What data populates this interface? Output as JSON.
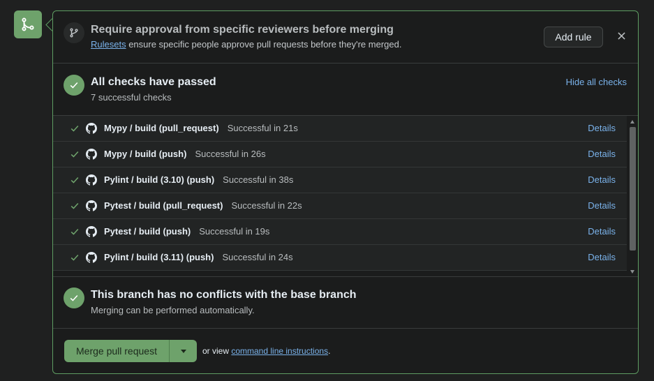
{
  "review": {
    "title": "Require approval from specific reviewers before merging",
    "link": "Rulesets",
    "subtitle_rest": " ensure specific people approve pull requests before they're merged.",
    "add_rule_label": "Add rule"
  },
  "checks": {
    "title": "All checks have passed",
    "subtitle": "7 successful checks",
    "hide_label": "Hide all checks",
    "items": [
      {
        "name": "Mypy / build (pull_request)",
        "status": "Successful in 21s",
        "details": "Details"
      },
      {
        "name": "Mypy / build (push)",
        "status": "Successful in 26s",
        "details": "Details"
      },
      {
        "name": "Pylint / build (3.10) (push)",
        "status": "Successful in 38s",
        "details": "Details"
      },
      {
        "name": "Pytest / build (pull_request)",
        "status": "Successful in 22s",
        "details": "Details"
      },
      {
        "name": "Pytest / build (push)",
        "status": "Successful in 19s",
        "details": "Details"
      },
      {
        "name": "Pylint / build (3.11) (push)",
        "status": "Successful in 24s",
        "details": "Details"
      }
    ]
  },
  "conflicts": {
    "title": "This branch has no conflicts with the base branch",
    "subtitle": "Merging can be performed automatically."
  },
  "merge": {
    "button_label": "Merge pull request",
    "or_view": "or view ",
    "cli_link": "command line instructions",
    "period": "."
  },
  "colors": {
    "success": "#6ea26b",
    "link": "#7ab2ea",
    "border": "#5e9d62"
  },
  "icons": {
    "badge": "git-merge-icon",
    "review": "git-branch-icon",
    "check": "check-icon",
    "provider": "github-icon",
    "close": "close-icon"
  }
}
